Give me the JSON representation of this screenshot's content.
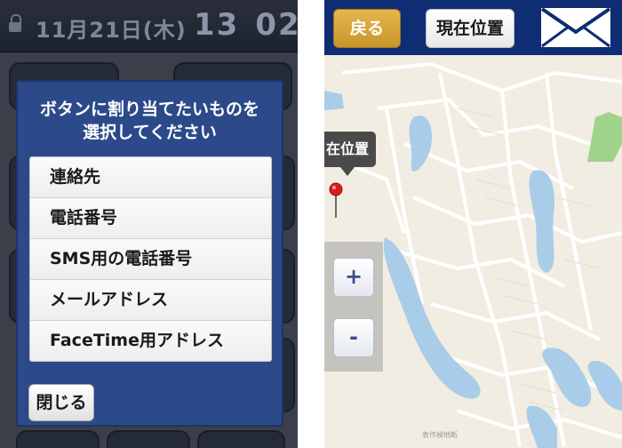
{
  "left_screen": {
    "status_bar": {
      "date": "11月21日(木)",
      "clock_hour": "13",
      "clock_minute": "02"
    },
    "dialog": {
      "title_line1": "ボタンに割り当てたいものを",
      "title_line2": "選択してください",
      "options": [
        "連絡先",
        "電話番号",
        "SMS用の電話番号",
        "メールアドレス",
        "FaceTime用アドレス"
      ],
      "close_label": "閉じる"
    }
  },
  "right_screen": {
    "toolbar": {
      "back_label": "戻る",
      "current_location_label": "現在位置",
      "mail_icon": "envelope-icon"
    },
    "map": {
      "marker_label": "在位置",
      "zoom_in_label": "+",
      "zoom_out_label": "-",
      "attribution": "表作検地断"
    }
  },
  "colors": {
    "dialog_blue": "#2c4a8a",
    "toolbar_navy": "#0f2d73",
    "back_button_gold": "#d4a43a",
    "water": "#a9cde8",
    "park": "#9ed38c",
    "land": "#f2ede2"
  }
}
